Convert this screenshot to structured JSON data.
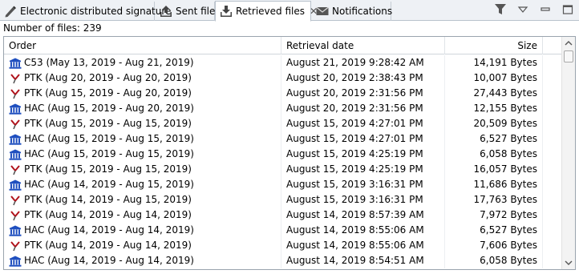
{
  "tabs": [
    {
      "label": "Electronic distributed signature",
      "icon": "pen-icon"
    },
    {
      "label": "Sent files",
      "icon": "upload-icon"
    },
    {
      "label": "Retrieved files",
      "icon": "download-icon",
      "active": true,
      "close": "✕"
    },
    {
      "label": "Notifications",
      "icon": "envelope-icon"
    }
  ],
  "toolbar_icons": [
    "filter-icon",
    "view-menu-icon",
    "minimize-icon",
    "maximize-icon"
  ],
  "count_text": "Number of files: 239",
  "columns": {
    "order": "Order",
    "date": "Retrieval date",
    "size": "Size"
  },
  "rows": [
    {
      "icon": "bank-icon",
      "order": "C53 (May 13, 2019 - Aug 21, 2019)",
      "date": "August 21, 2019 9:28:42 AM",
      "size": "14,191 Bytes"
    },
    {
      "icon": "ptk-logo-icon",
      "order": "PTK (Aug 20, 2019 - Aug 20, 2019)",
      "date": "August 20, 2019 2:38:43 PM",
      "size": "10,007 Bytes"
    },
    {
      "icon": "ptk-logo-icon",
      "order": "PTK (Aug 15, 2019 - Aug 20, 2019)",
      "date": "August 20, 2019 2:31:56 PM",
      "size": "27,443 Bytes"
    },
    {
      "icon": "bank-icon",
      "order": "HAC (Aug 15, 2019 - Aug 20, 2019)",
      "date": "August 20, 2019 2:31:56 PM",
      "size": "12,155 Bytes"
    },
    {
      "icon": "ptk-logo-icon",
      "order": "PTK (Aug 15, 2019 - Aug 15, 2019)",
      "date": "August 15, 2019 4:27:01 PM",
      "size": "20,509 Bytes"
    },
    {
      "icon": "bank-icon",
      "order": "HAC (Aug 15, 2019 - Aug 15, 2019)",
      "date": "August 15, 2019 4:27:01 PM",
      "size": "6,527 Bytes"
    },
    {
      "icon": "bank-icon",
      "order": "HAC (Aug 15, 2019 - Aug 15, 2019)",
      "date": "August 15, 2019 4:25:19 PM",
      "size": "6,058 Bytes"
    },
    {
      "icon": "ptk-logo-icon",
      "order": "PTK (Aug 15, 2019 - Aug 15, 2019)",
      "date": "August 15, 2019 4:25:19 PM",
      "size": "16,057 Bytes"
    },
    {
      "icon": "bank-icon",
      "order": "HAC (Aug 14, 2019 - Aug 15, 2019)",
      "date": "August 15, 2019 3:16:31 PM",
      "size": "11,686 Bytes"
    },
    {
      "icon": "ptk-logo-icon",
      "order": "PTK (Aug 14, 2019 - Aug 15, 2019)",
      "date": "August 15, 2019 3:16:31 PM",
      "size": "17,763 Bytes"
    },
    {
      "icon": "ptk-logo-icon",
      "order": "PTK (Aug 14, 2019 - Aug 14, 2019)",
      "date": "August 14, 2019 8:57:39 AM",
      "size": "7,972 Bytes"
    },
    {
      "icon": "bank-icon",
      "order": "HAC (Aug 14, 2019 - Aug 14, 2019)",
      "date": "August 14, 2019 8:55:06 AM",
      "size": "6,527 Bytes"
    },
    {
      "icon": "ptk-logo-icon",
      "order": "PTK (Aug 14, 2019 - Aug 14, 2019)",
      "date": "August 14, 2019 8:55:06 AM",
      "size": "7,606 Bytes"
    },
    {
      "icon": "bank-icon",
      "order": "HAC (Aug 14, 2019 - Aug 14, 2019)",
      "date": "August 14, 2019 8:54:51 AM",
      "size": "6,058 Bytes"
    }
  ],
  "colors": {
    "bank": "#1f4fbf",
    "ptk": "#b0121b",
    "tab_bg": "#eef1f5",
    "border": "#9aa4ae"
  }
}
